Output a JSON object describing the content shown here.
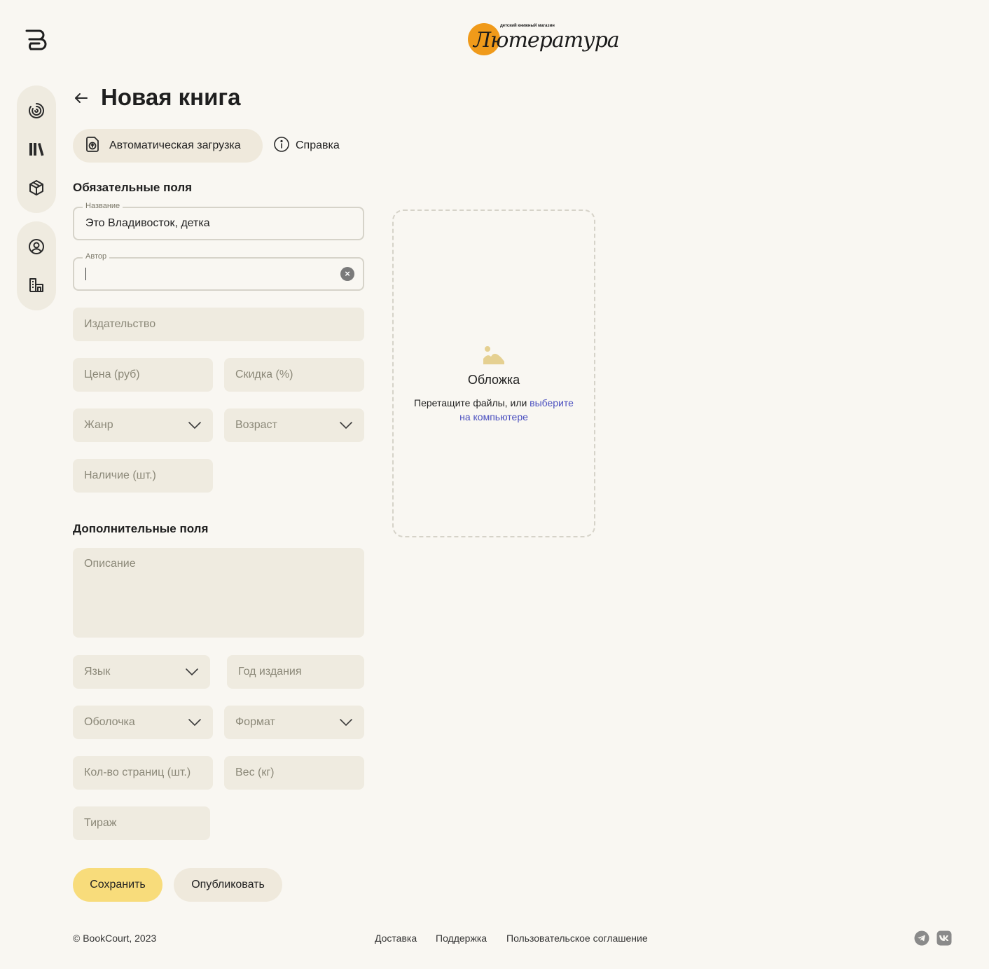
{
  "brand": {
    "wordmark": "Лютература",
    "tagline": "детский книжный магазин",
    "accent": "#f09a1a"
  },
  "sidebar": {
    "items": [
      {
        "icon": "dashboard-spiral-icon"
      },
      {
        "icon": "books-library-icon"
      },
      {
        "icon": "package-box-icon"
      },
      {
        "icon": "profile-user-icon"
      },
      {
        "icon": "store-building-icon"
      }
    ]
  },
  "header": {
    "title": "Новая книга",
    "auto_upload_label": "Автоматическая загрузка",
    "help_label": "Справка"
  },
  "required": {
    "section_title": "Обязательные поля",
    "title_field": {
      "legend": "Название",
      "value": "Это Владивосток, детка"
    },
    "author_field": {
      "legend": "Автор",
      "value": ""
    },
    "publisher_placeholder": "Издательство",
    "price_placeholder": "Цена (руб)",
    "discount_placeholder": "Скидка (%)",
    "genre_placeholder": "Жанр",
    "age_placeholder": "Возраст",
    "stock_placeholder": "Наличие (шт.)"
  },
  "optional": {
    "section_title": "Дополнительные поля",
    "description_placeholder": "Описание",
    "language_placeholder": "Язык",
    "year_placeholder": "Год издания",
    "cover_type_placeholder": "Оболочка",
    "format_placeholder": "Формат",
    "pages_placeholder": "Кол-во страниц (шт.)",
    "weight_placeholder": "Вес (кг)",
    "edition_placeholder": "Тираж"
  },
  "cover": {
    "title": "Обложка",
    "hint_prefix": "Перетащите файлы, или ",
    "hint_link": "выберите на компьютере"
  },
  "actions": {
    "save_label": "Сохранить",
    "publish_label": "Опубликовать",
    "save_color": "#f8dc7b"
  },
  "footer": {
    "copyright": "© BookCourt, 2023",
    "links": [
      "Доставка",
      "Поддержка",
      "Пользовательское соглашение"
    ],
    "social": [
      "telegram-icon",
      "vk-icon"
    ]
  }
}
